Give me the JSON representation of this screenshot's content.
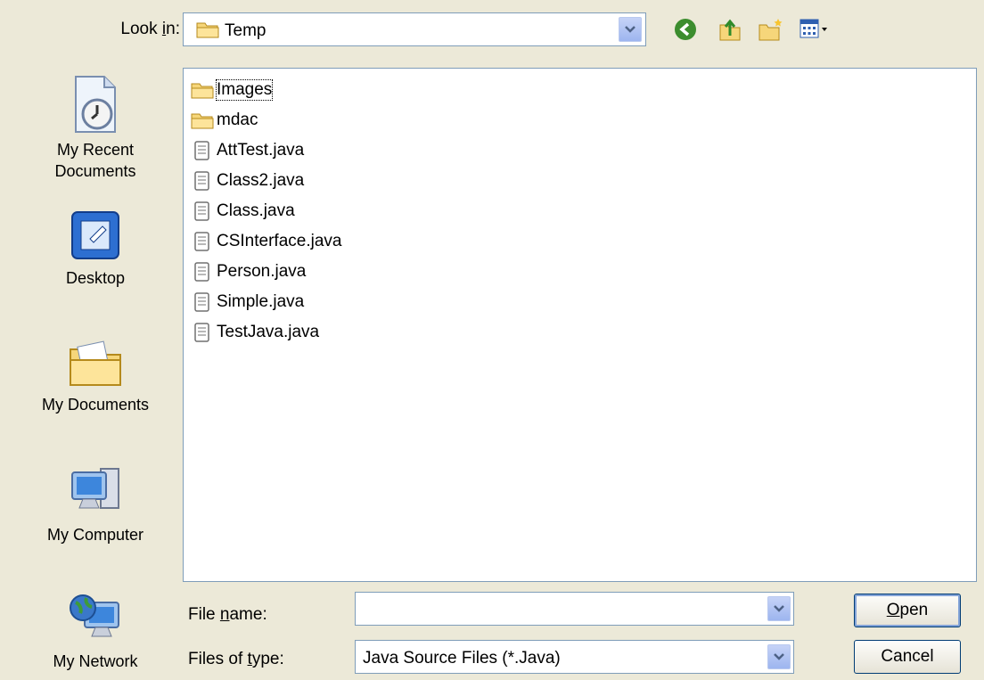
{
  "lookin": {
    "label_pre": "Look ",
    "label_key": "i",
    "label_post": "n:",
    "value": "Temp"
  },
  "places": [
    {
      "label": "My Recent Documents",
      "icon": "recent-documents-icon"
    },
    {
      "label": "Desktop",
      "icon": "desktop-icon"
    },
    {
      "label": "My Documents",
      "icon": "my-documents-icon"
    },
    {
      "label": "My Computer",
      "icon": "my-computer-icon"
    },
    {
      "label": "My Network",
      "icon": "my-network-icon"
    }
  ],
  "files": [
    {
      "name": "Images",
      "kind": "folder"
    },
    {
      "name": "mdac",
      "kind": "folder"
    },
    {
      "name": "AttTest.java",
      "kind": "file"
    },
    {
      "name": "Class2.java",
      "kind": "file"
    },
    {
      "name": "Class.java",
      "kind": "file"
    },
    {
      "name": "CSInterface.java",
      "kind": "file"
    },
    {
      "name": "Person.java",
      "kind": "file"
    },
    {
      "name": "Simple.java",
      "kind": "file"
    },
    {
      "name": "TestJava.java",
      "kind": "file"
    }
  ],
  "filename": {
    "label_pre": "File ",
    "label_key": "n",
    "label_post": "ame:",
    "value": ""
  },
  "filetype": {
    "label_pre": "Files of ",
    "label_key": "t",
    "label_post": "ype:",
    "value": "Java Source Files (*.Java)"
  },
  "buttons": {
    "open_key": "O",
    "open_rest": "pen",
    "cancel": "Cancel"
  },
  "colors": {
    "accent": "#003c74",
    "window": "#ece9d8",
    "border": "#7f9db9"
  }
}
